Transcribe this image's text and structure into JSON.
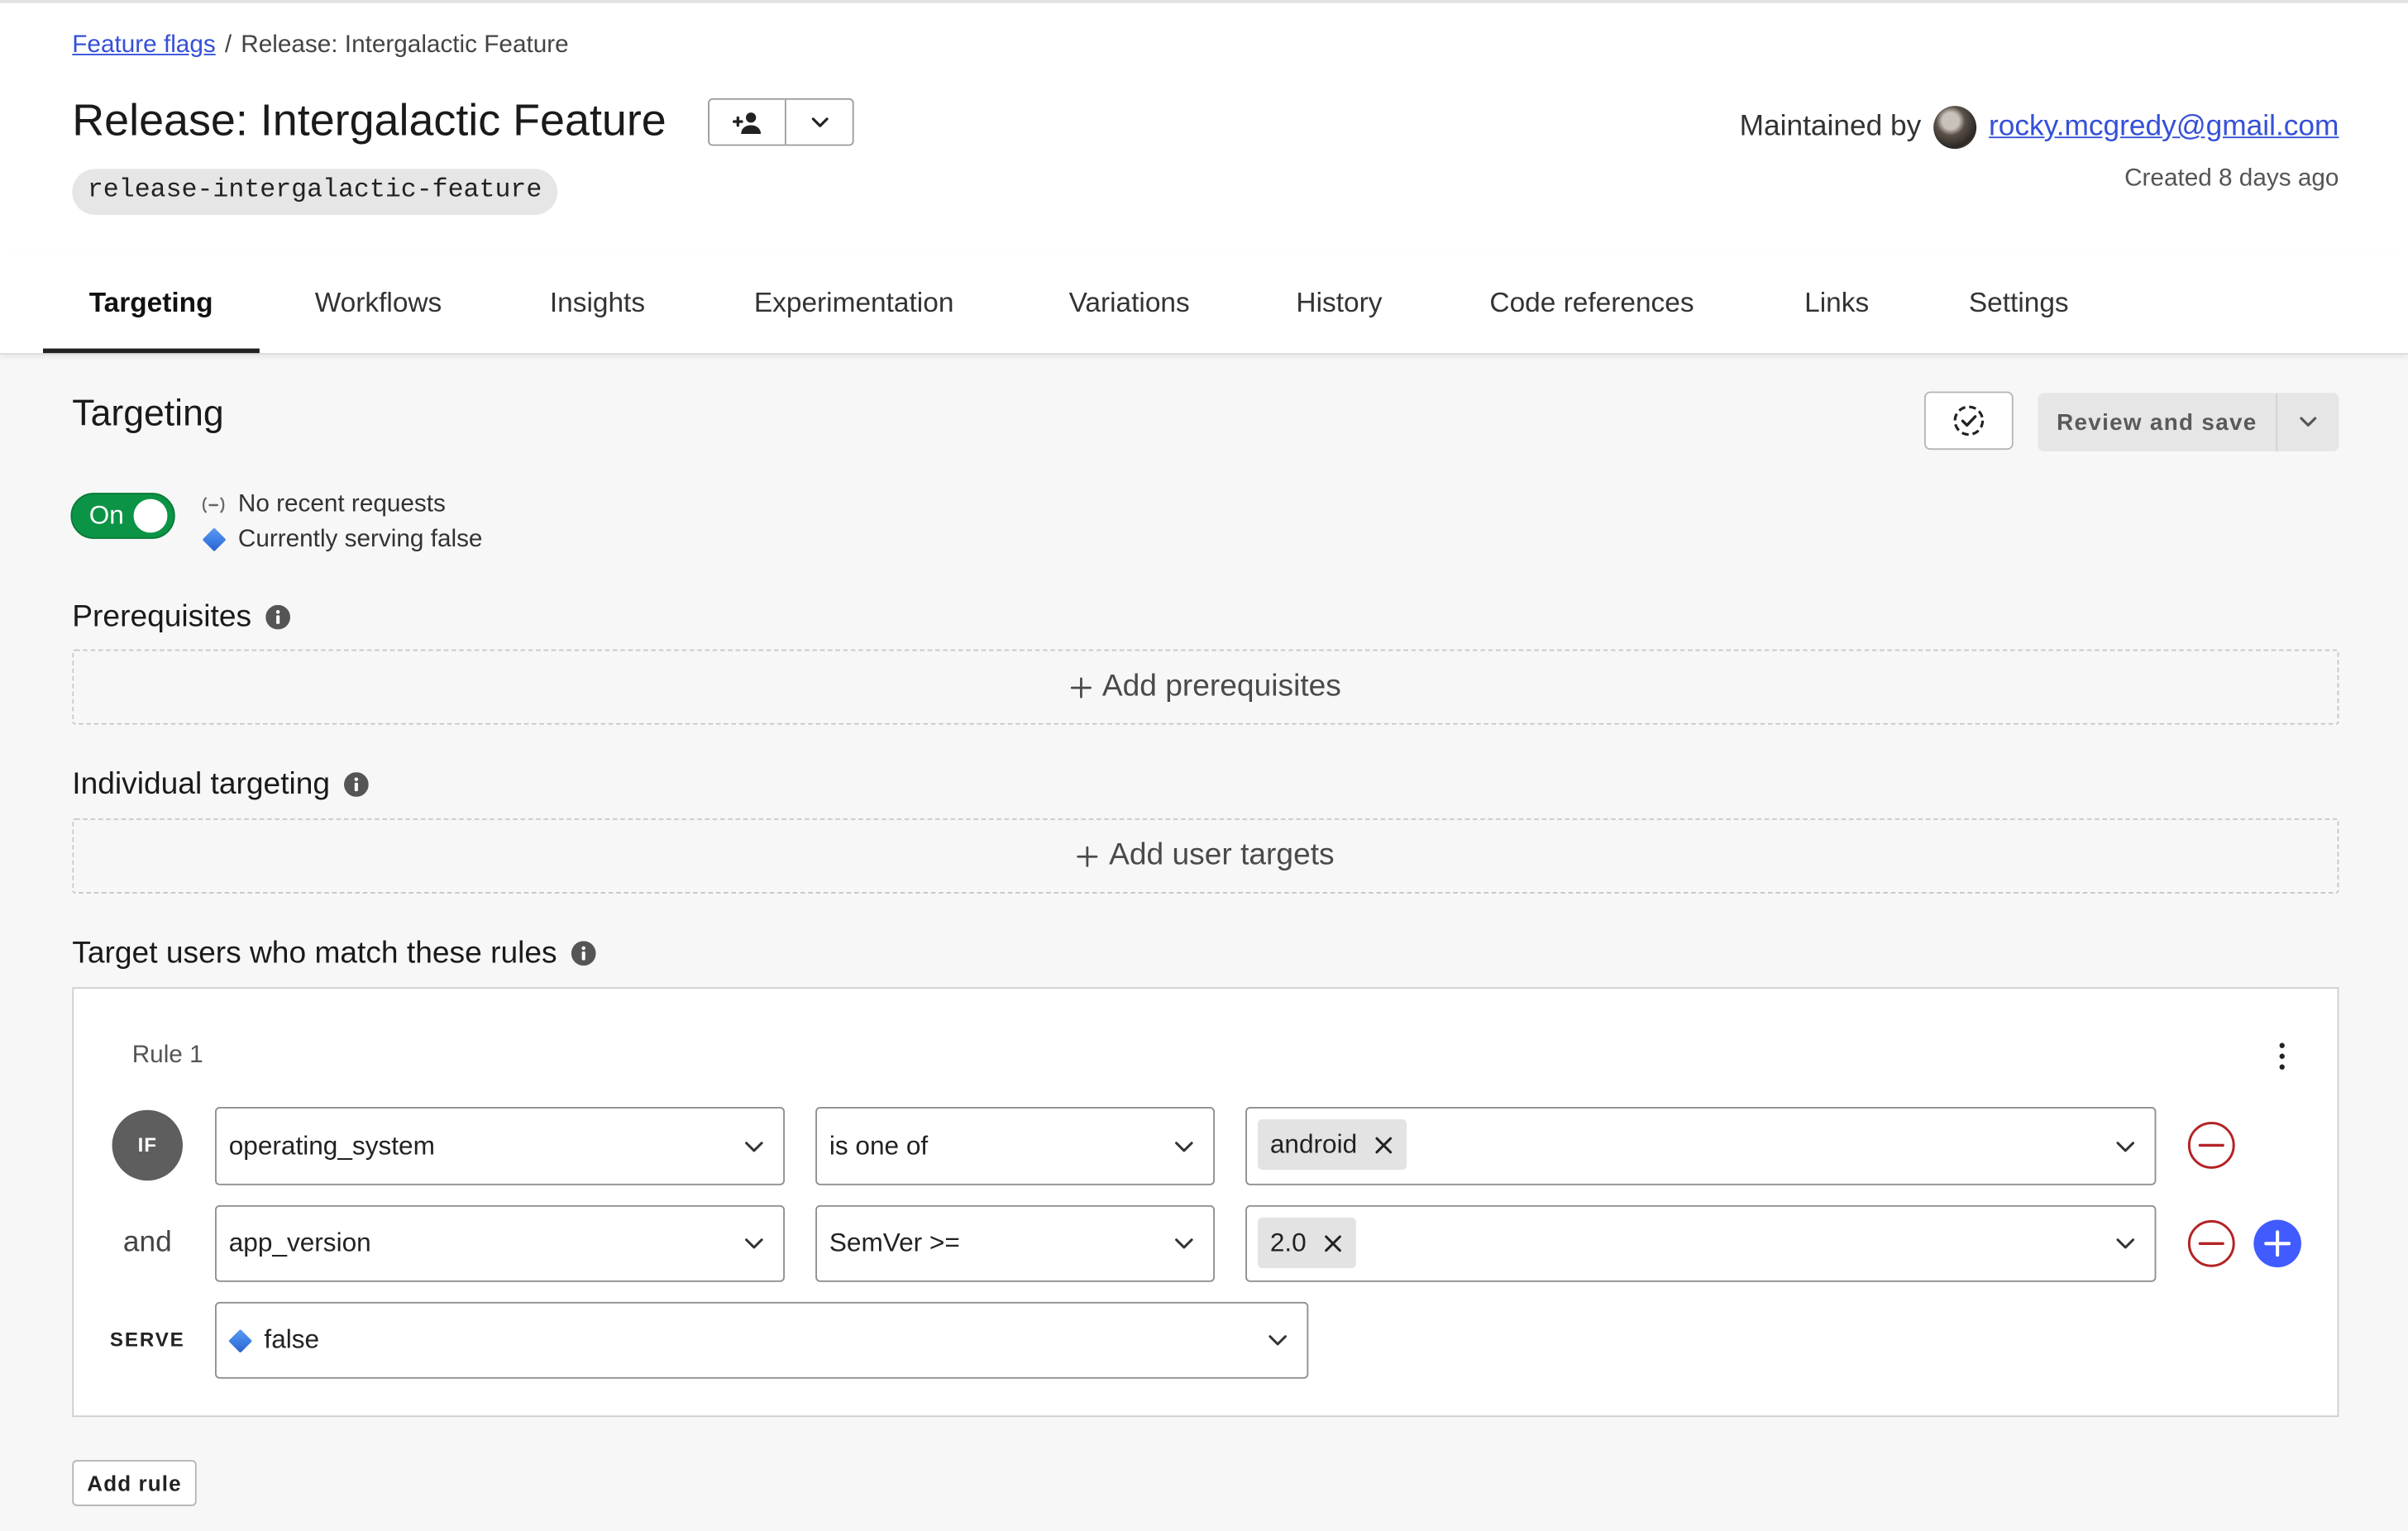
{
  "breadcrumb": {
    "parent": "Feature flags",
    "separator": "/",
    "current": "Release: Intergalactic Feature"
  },
  "header": {
    "title": "Release: Intergalactic Feature",
    "flag_key": "release-intergalactic-feature",
    "maintained_by_label": "Maintained by",
    "maintainer_email": "rocky.mcgredy@gmail.com",
    "created": "Created 8 days ago"
  },
  "tabs": [
    {
      "label": "Targeting",
      "active": true
    },
    {
      "label": "Workflows",
      "active": false
    },
    {
      "label": "Insights",
      "active": false
    },
    {
      "label": "Experimentation",
      "active": false
    },
    {
      "label": "Variations",
      "active": false
    },
    {
      "label": "History",
      "active": false
    },
    {
      "label": "Code references",
      "active": false
    },
    {
      "label": "Links",
      "active": false
    },
    {
      "label": "Settings",
      "active": false
    }
  ],
  "targeting": {
    "heading": "Targeting",
    "review_save_label": "Review and save",
    "toggle": {
      "label": "On",
      "on": true
    },
    "status": {
      "requests": "No recent requests",
      "serving": "Currently serving false"
    }
  },
  "prerequisites": {
    "heading": "Prerequisites",
    "add_label": "Add prerequisites"
  },
  "individual_targeting": {
    "heading": "Individual targeting",
    "add_label": "Add user targets"
  },
  "rules_section": {
    "heading": "Target users who match these rules",
    "add_rule_label": "Add rule"
  },
  "rules": [
    {
      "label": "Rule 1",
      "clauses": [
        {
          "prefix": "IF",
          "attribute": "operating_system",
          "operator": "is one of",
          "values": [
            "android"
          ]
        },
        {
          "prefix": "and",
          "attribute": "app_version",
          "operator": "SemVer >=",
          "values": [
            "2.0"
          ]
        }
      ],
      "serve_label": "SERVE",
      "serve_value": "false"
    }
  ],
  "icons": {
    "add_maintainer": "person-add-icon",
    "flag_actions": "chevron-down-icon",
    "validate": "check-circle-icon",
    "status_requests": "no-requests-icon",
    "status_serving": "diamond-icon",
    "section_info": "info-icon",
    "add_section_item": "plus-icon",
    "rule_menu": "kebab-menu-icon",
    "remove_value": "close-icon",
    "remove_clause": "minus-circle-icon",
    "add_clause": "plus-circle-icon"
  },
  "colors": {
    "link": "#3550d8",
    "toggle_on": "#0b9445",
    "variation_false": "#3a7be2",
    "remove": "#b42326",
    "add": "#405bff",
    "if_badge": "#5e5e5e",
    "page_bg": "#f7f7f7"
  }
}
